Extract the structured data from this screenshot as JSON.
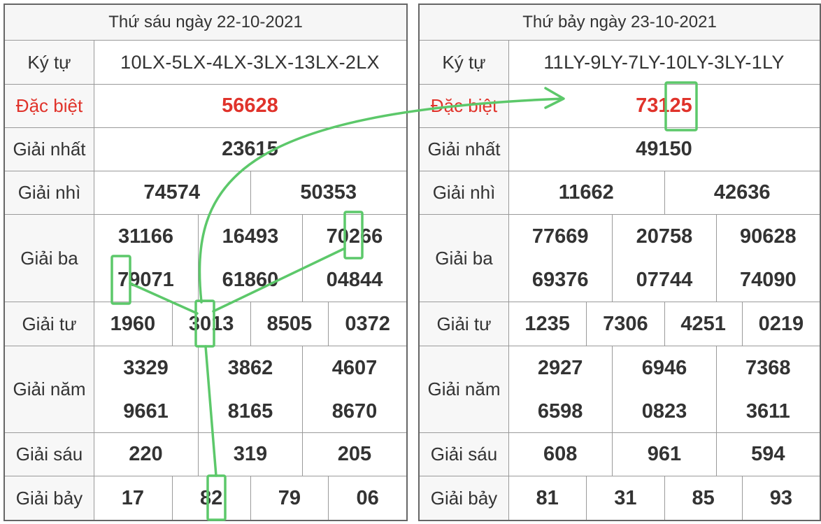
{
  "left": {
    "date": "Thứ sáu ngày 22-10-2021",
    "labels": {
      "kytu": "Ký tự",
      "dacbiet": "Đặc biệt",
      "nhat": "Giải nhất",
      "nhi": "Giải nhì",
      "ba": "Giải ba",
      "tu": "Giải tư",
      "nam": "Giải năm",
      "sau": "Giải sáu",
      "bay": "Giải bảy"
    },
    "kytu": "10LX-5LX-4LX-3LX-13LX-2LX",
    "dacbiet": "56628",
    "nhat": "23615",
    "nhi": [
      "74574",
      "50353"
    ],
    "ba": [
      "31166",
      "16493",
      "70266",
      "79071",
      "61860",
      "04844"
    ],
    "tu": [
      "1960",
      "3013",
      "8505",
      "0372"
    ],
    "nam": [
      "3329",
      "3862",
      "4607",
      "9661",
      "8165",
      "8670"
    ],
    "sau": [
      "220",
      "319",
      "205"
    ],
    "bay": [
      "17",
      "82",
      "79",
      "06"
    ]
  },
  "right": {
    "date": "Thứ bảy ngày 23-10-2021",
    "labels": {
      "kytu": "Ký tự",
      "dacbiet": "Đặc biệt",
      "nhat": "Giải nhất",
      "nhi": "Giải nhì",
      "ba": "Giải ba",
      "tu": "Giải tư",
      "nam": "Giải năm",
      "sau": "Giải sáu",
      "bay": "Giải bảy"
    },
    "kytu": "11LY-9LY-7LY-10LY-3LY-1LY",
    "dacbiet": "73125",
    "nhat": "49150",
    "nhi": [
      "11662",
      "42636"
    ],
    "ba": [
      "77669",
      "20758",
      "90628",
      "69376",
      "07744",
      "74090"
    ],
    "tu": [
      "1235",
      "7306",
      "4251",
      "0219"
    ],
    "nam": [
      "2927",
      "6946",
      "7368",
      "6598",
      "0823",
      "3611"
    ],
    "sau": [
      "608",
      "961",
      "594"
    ],
    "bay": [
      "81",
      "31",
      "85",
      "93"
    ]
  },
  "colors": {
    "special": "#e0332b",
    "highlight": "#5cc86a"
  }
}
